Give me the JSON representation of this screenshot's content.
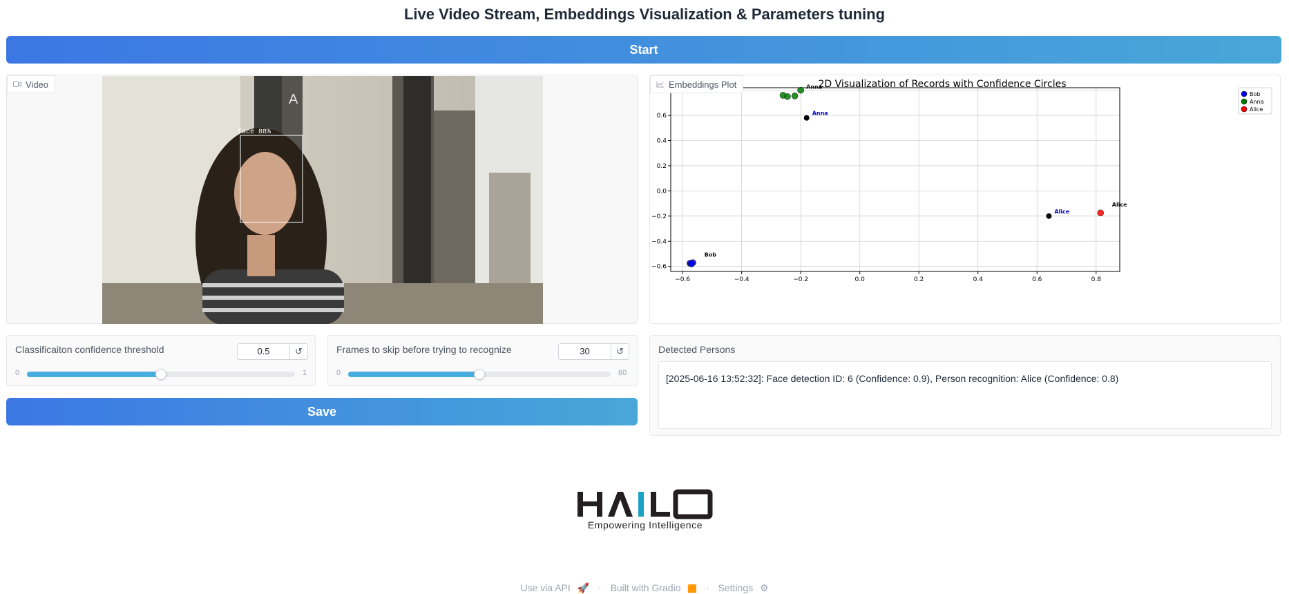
{
  "page": {
    "title": "Live Video Stream, Embeddings Visualization & Parameters tuning"
  },
  "start_button": {
    "label": "Start"
  },
  "video": {
    "label": "Video",
    "overlay_text": "face 88%"
  },
  "plot": {
    "label": "Embeddings Plot",
    "title": "2D Visualization of Records with Confidence Circles"
  },
  "chart_data": {
    "type": "scatter",
    "title": "2D Visualization of Records with Confidence Circles",
    "xlim": [
      -0.64,
      0.88
    ],
    "ylim": [
      -0.64,
      0.82
    ],
    "x_ticks": [
      "−0.6",
      "−0.4",
      "−0.2",
      "0.0",
      "0.2",
      "0.4",
      "0.6",
      "0.8"
    ],
    "y_ticks": [
      "0.8",
      "0.6",
      "0.4",
      "0.2",
      "0.0",
      "−0.2",
      "−0.4",
      "−0.6"
    ],
    "x_tick_values": [
      -0.6,
      -0.4,
      -0.2,
      0.0,
      0.2,
      0.4,
      0.6,
      0.8
    ],
    "y_tick_values": [
      0.8,
      0.6,
      0.4,
      0.2,
      0.0,
      -0.2,
      -0.4,
      -0.6
    ],
    "grid": true,
    "legend_position": "top-right",
    "series": [
      {
        "name": "Bob",
        "color": "#0000ff",
        "points": [
          [
            -0.575,
            -0.575
          ],
          [
            -0.565,
            -0.57
          ],
          [
            -0.57,
            -0.58
          ]
        ]
      },
      {
        "name": "Anna",
        "color": "#008000",
        "points": [
          [
            -0.245,
            0.75
          ],
          [
            -0.26,
            0.76
          ],
          [
            -0.22,
            0.755
          ],
          [
            -0.2,
            0.8
          ]
        ]
      },
      {
        "name": "Alice",
        "color": "#ff0000",
        "points": [
          [
            0.815,
            -0.175
          ]
        ]
      }
    ],
    "annotations": [
      {
        "text": "Anna",
        "x": -0.18,
        "y": 0.58,
        "color": "#0000cc"
      },
      {
        "text": "Alice",
        "x": 0.64,
        "y": -0.2,
        "color": "#0000cc"
      },
      {
        "text": "Bob",
        "x": -0.545,
        "y": -0.545,
        "color": "#111111"
      },
      {
        "text": "Alice",
        "x": 0.835,
        "y": -0.145,
        "color": "#111111"
      },
      {
        "text": "Anna",
        "x": -0.2,
        "y": 0.79,
        "color": "#111111"
      }
    ],
    "reference_points": [
      [
        -0.18,
        0.58
      ],
      [
        0.64,
        -0.2
      ]
    ]
  },
  "confidence_slider": {
    "label": "Classificaiton confidence threshold",
    "value": "0.5",
    "min": "0",
    "max": "1",
    "fraction": 0.5
  },
  "skip_slider": {
    "label": "Frames to skip before trying to recognize",
    "value": "30",
    "min": "0",
    "max": "60",
    "fraction": 0.5
  },
  "reset_icon": "↺",
  "save_button": {
    "label": "Save"
  },
  "detected": {
    "label": "Detected Persons",
    "text": "[2025-06-16 13:52:32]: Face detection ID: 6 (Confidence: 0.9), Person recognition: Alice (Confidence: 0.8)"
  },
  "logo": {
    "name": "HAILO",
    "tagline": "Empowering Intelligence"
  },
  "footer": {
    "api": "Use via API",
    "api_icon": "🚀",
    "gradio": "Built with Gradio",
    "gradio_icon": "🟧",
    "settings": "Settings",
    "settings_icon": "⚙",
    "sep": "·"
  }
}
